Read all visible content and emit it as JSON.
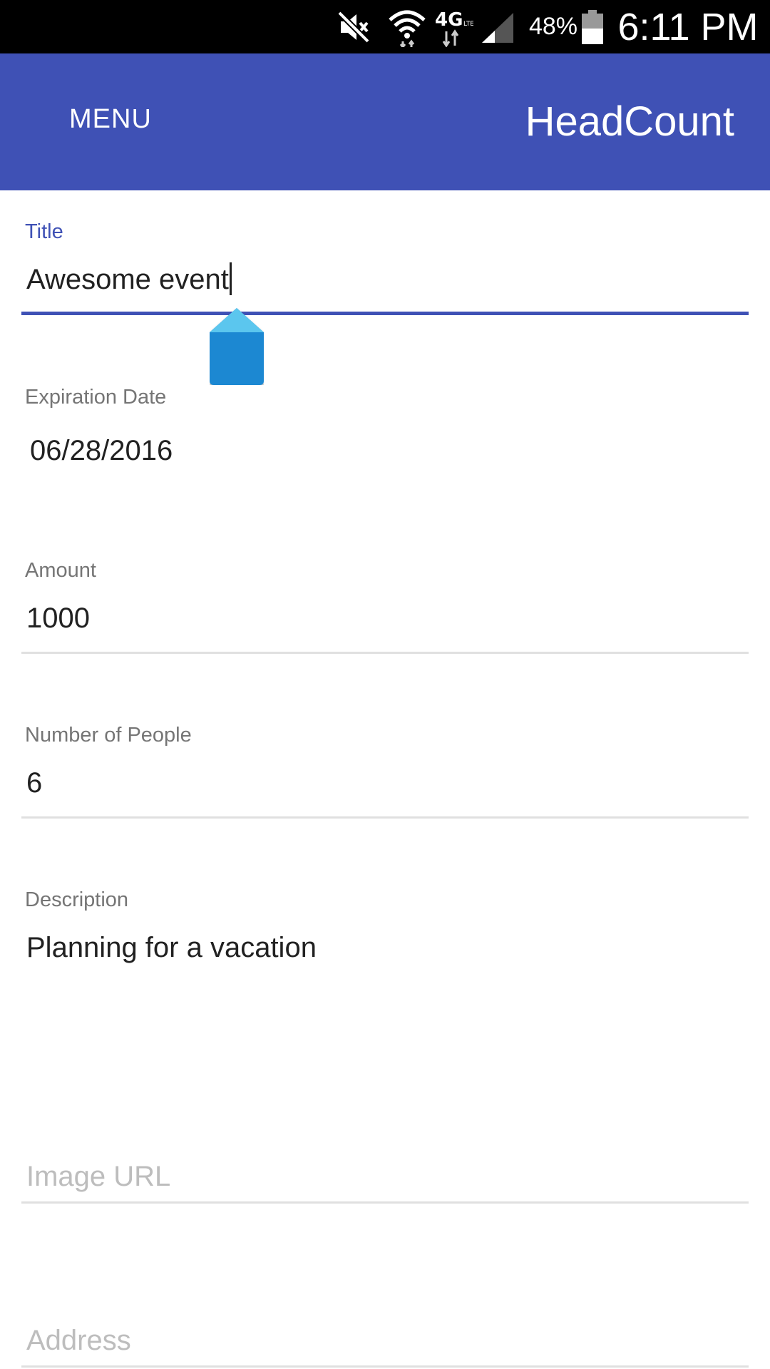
{
  "status_bar": {
    "battery_percent": "48%",
    "time": "6:11 PM",
    "icons": [
      "mute-icon",
      "wifi-icon",
      "lte-4g-icon",
      "cell-signal-icon",
      "battery-icon"
    ]
  },
  "app_bar": {
    "menu_label": "MENU",
    "title": "HeadCount",
    "color": "#3f51b5"
  },
  "form": {
    "title": {
      "label": "Title",
      "value": "Awesome event"
    },
    "expiration_date": {
      "label": "Expiration Date",
      "value": "06/28/2016"
    },
    "amount": {
      "label": "Amount",
      "value": "1000"
    },
    "number_of_people": {
      "label": "Number of People",
      "value": "6"
    },
    "description": {
      "label": "Description",
      "value": "Planning for a vacation"
    },
    "image_url": {
      "placeholder": "Image URL"
    },
    "address": {
      "placeholder": "Address"
    }
  },
  "colors": {
    "accent": "#3f51b5",
    "handle": "#2196d9",
    "label": "#757575",
    "text": "#212121",
    "hint": "#bdbdbd"
  }
}
